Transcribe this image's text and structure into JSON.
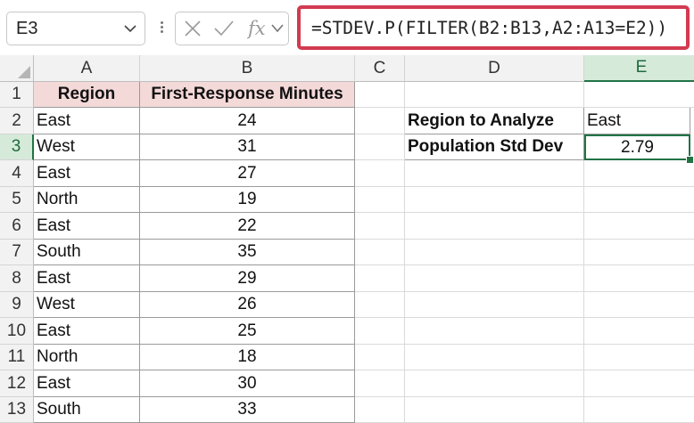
{
  "name_box": {
    "value": "E3"
  },
  "formula_bar": {
    "formula": "=STDEV.P(FILTER(B2:B13,A2:A13=E2))",
    "cancel_icon": "x-icon",
    "enter_icon": "check-icon",
    "function_icon": "fx-icon"
  },
  "columns": [
    "A",
    "B",
    "C",
    "D",
    "E"
  ],
  "rows": [
    "1",
    "2",
    "3",
    "4",
    "5",
    "6",
    "7",
    "8",
    "9",
    "10",
    "11",
    "12",
    "13"
  ],
  "table": {
    "headers": [
      "Region",
      "First-Response Minutes"
    ],
    "data": [
      [
        "East",
        "24"
      ],
      [
        "West",
        "31"
      ],
      [
        "East",
        "27"
      ],
      [
        "North",
        "19"
      ],
      [
        "East",
        "22"
      ],
      [
        "South",
        "35"
      ],
      [
        "East",
        "29"
      ],
      [
        "West",
        "26"
      ],
      [
        "East",
        "25"
      ],
      [
        "North",
        "18"
      ],
      [
        "East",
        "30"
      ],
      [
        "South",
        "33"
      ]
    ]
  },
  "analysis": {
    "region_label": "Region to Analyze",
    "region_value": "East",
    "stdev_label": "Population Std Dev",
    "stdev_value": "2.79"
  },
  "colors": {
    "header_fill": "#f4d9d9",
    "selection_green": "#217346",
    "formula_highlight": "#d23a50"
  },
  "selected_cell": "E3"
}
